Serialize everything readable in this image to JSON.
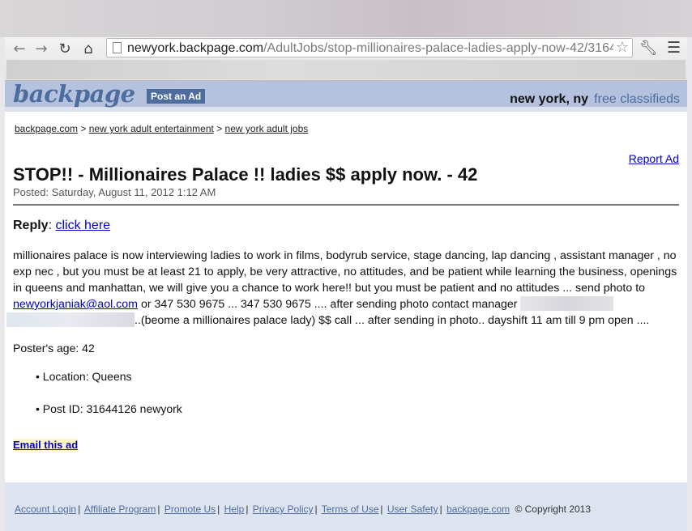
{
  "browser": {
    "url_host": "newyork.backpage.com",
    "url_path": "/AdultJobs/stop-millionaires-palace-ladies-apply-now-42/3164",
    "icons": [
      "back-icon",
      "forward-icon",
      "reload-icon",
      "home-icon",
      "page-icon",
      "star-icon",
      "wrench-icon",
      "menu-icon"
    ]
  },
  "header": {
    "logo": "backpage",
    "post_ad": "Post an Ad",
    "city": "new york, ny",
    "tagline": "free classifieds",
    "colors": {
      "bar": "#b4c2de",
      "brand": "#4d6d9e"
    }
  },
  "breadcrumb": {
    "items": [
      "backpage.com",
      "new york adult entertainment",
      "new york adult jobs"
    ],
    "separator": ">"
  },
  "ad": {
    "report": "Report Ad",
    "title": "STOP!! - Millionaires Palace !! ladies $$ apply now. - 42",
    "posted": "Posted: Saturday, August 11, 2012 1:12 AM",
    "reply_label": "Reply",
    "reply_link": "click here",
    "body_part1": "millionaires palace is now interviewing ladies to work in films, bodyrub service, stage dancing, lap dancing , assistant manager , no exp nec , but you must be at least 21 to apply, be very attractive, no attitudes, and be patient while learning the business, openings in queens and manhattan, we will give you a chance to work here!! but you must be patient and no attitudes ... send photo to",
    "body_email": "newyorkjaniak@aol.com",
    "body_part2": "or 347 530 9675 ... 347 530 9675 .... after sending photo contact manager",
    "body_part3": "..(beome a millionaires palace lady) $$ call ... after sending in photo.. dayshift 11 am till 9 pm open ....",
    "age": "Poster's age: 42",
    "location": "• Location: Queens",
    "post_id": "• Post ID: 31644126 newyork",
    "email_ad": "Email this ad"
  },
  "footer": {
    "links": [
      "Account Login",
      "Affiliate Program",
      "Promote Us",
      "Help",
      "Privacy Policy",
      "Terms of Use",
      "User Safety",
      "backpage.com"
    ],
    "copyright": "© Copyright 2013"
  }
}
